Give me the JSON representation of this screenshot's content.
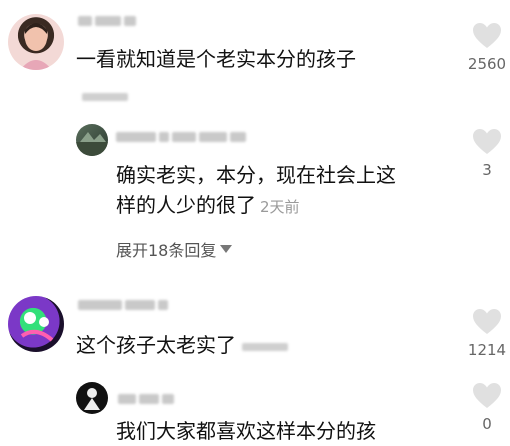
{
  "comments": [
    {
      "text": "一看就知道是个老实本分的孩子",
      "likes": "2560"
    },
    {
      "text_line1": "确实老实，本分，现在社会上这",
      "text_line2": "样的人少的很了",
      "time": "2天前",
      "likes": "3"
    },
    {
      "expand_label": "展开18条回复"
    },
    {
      "text": "这个孩子太老实了",
      "likes": "1214"
    },
    {
      "text": "我们大家都喜欢这样本分的孩",
      "likes": "0"
    }
  ],
  "icons": {
    "like": "heart-icon",
    "expand": "triangle-down-icon"
  },
  "colors": {
    "text": "#111111",
    "meta": "#9a9a9a",
    "heart": "#e0e0e0"
  }
}
